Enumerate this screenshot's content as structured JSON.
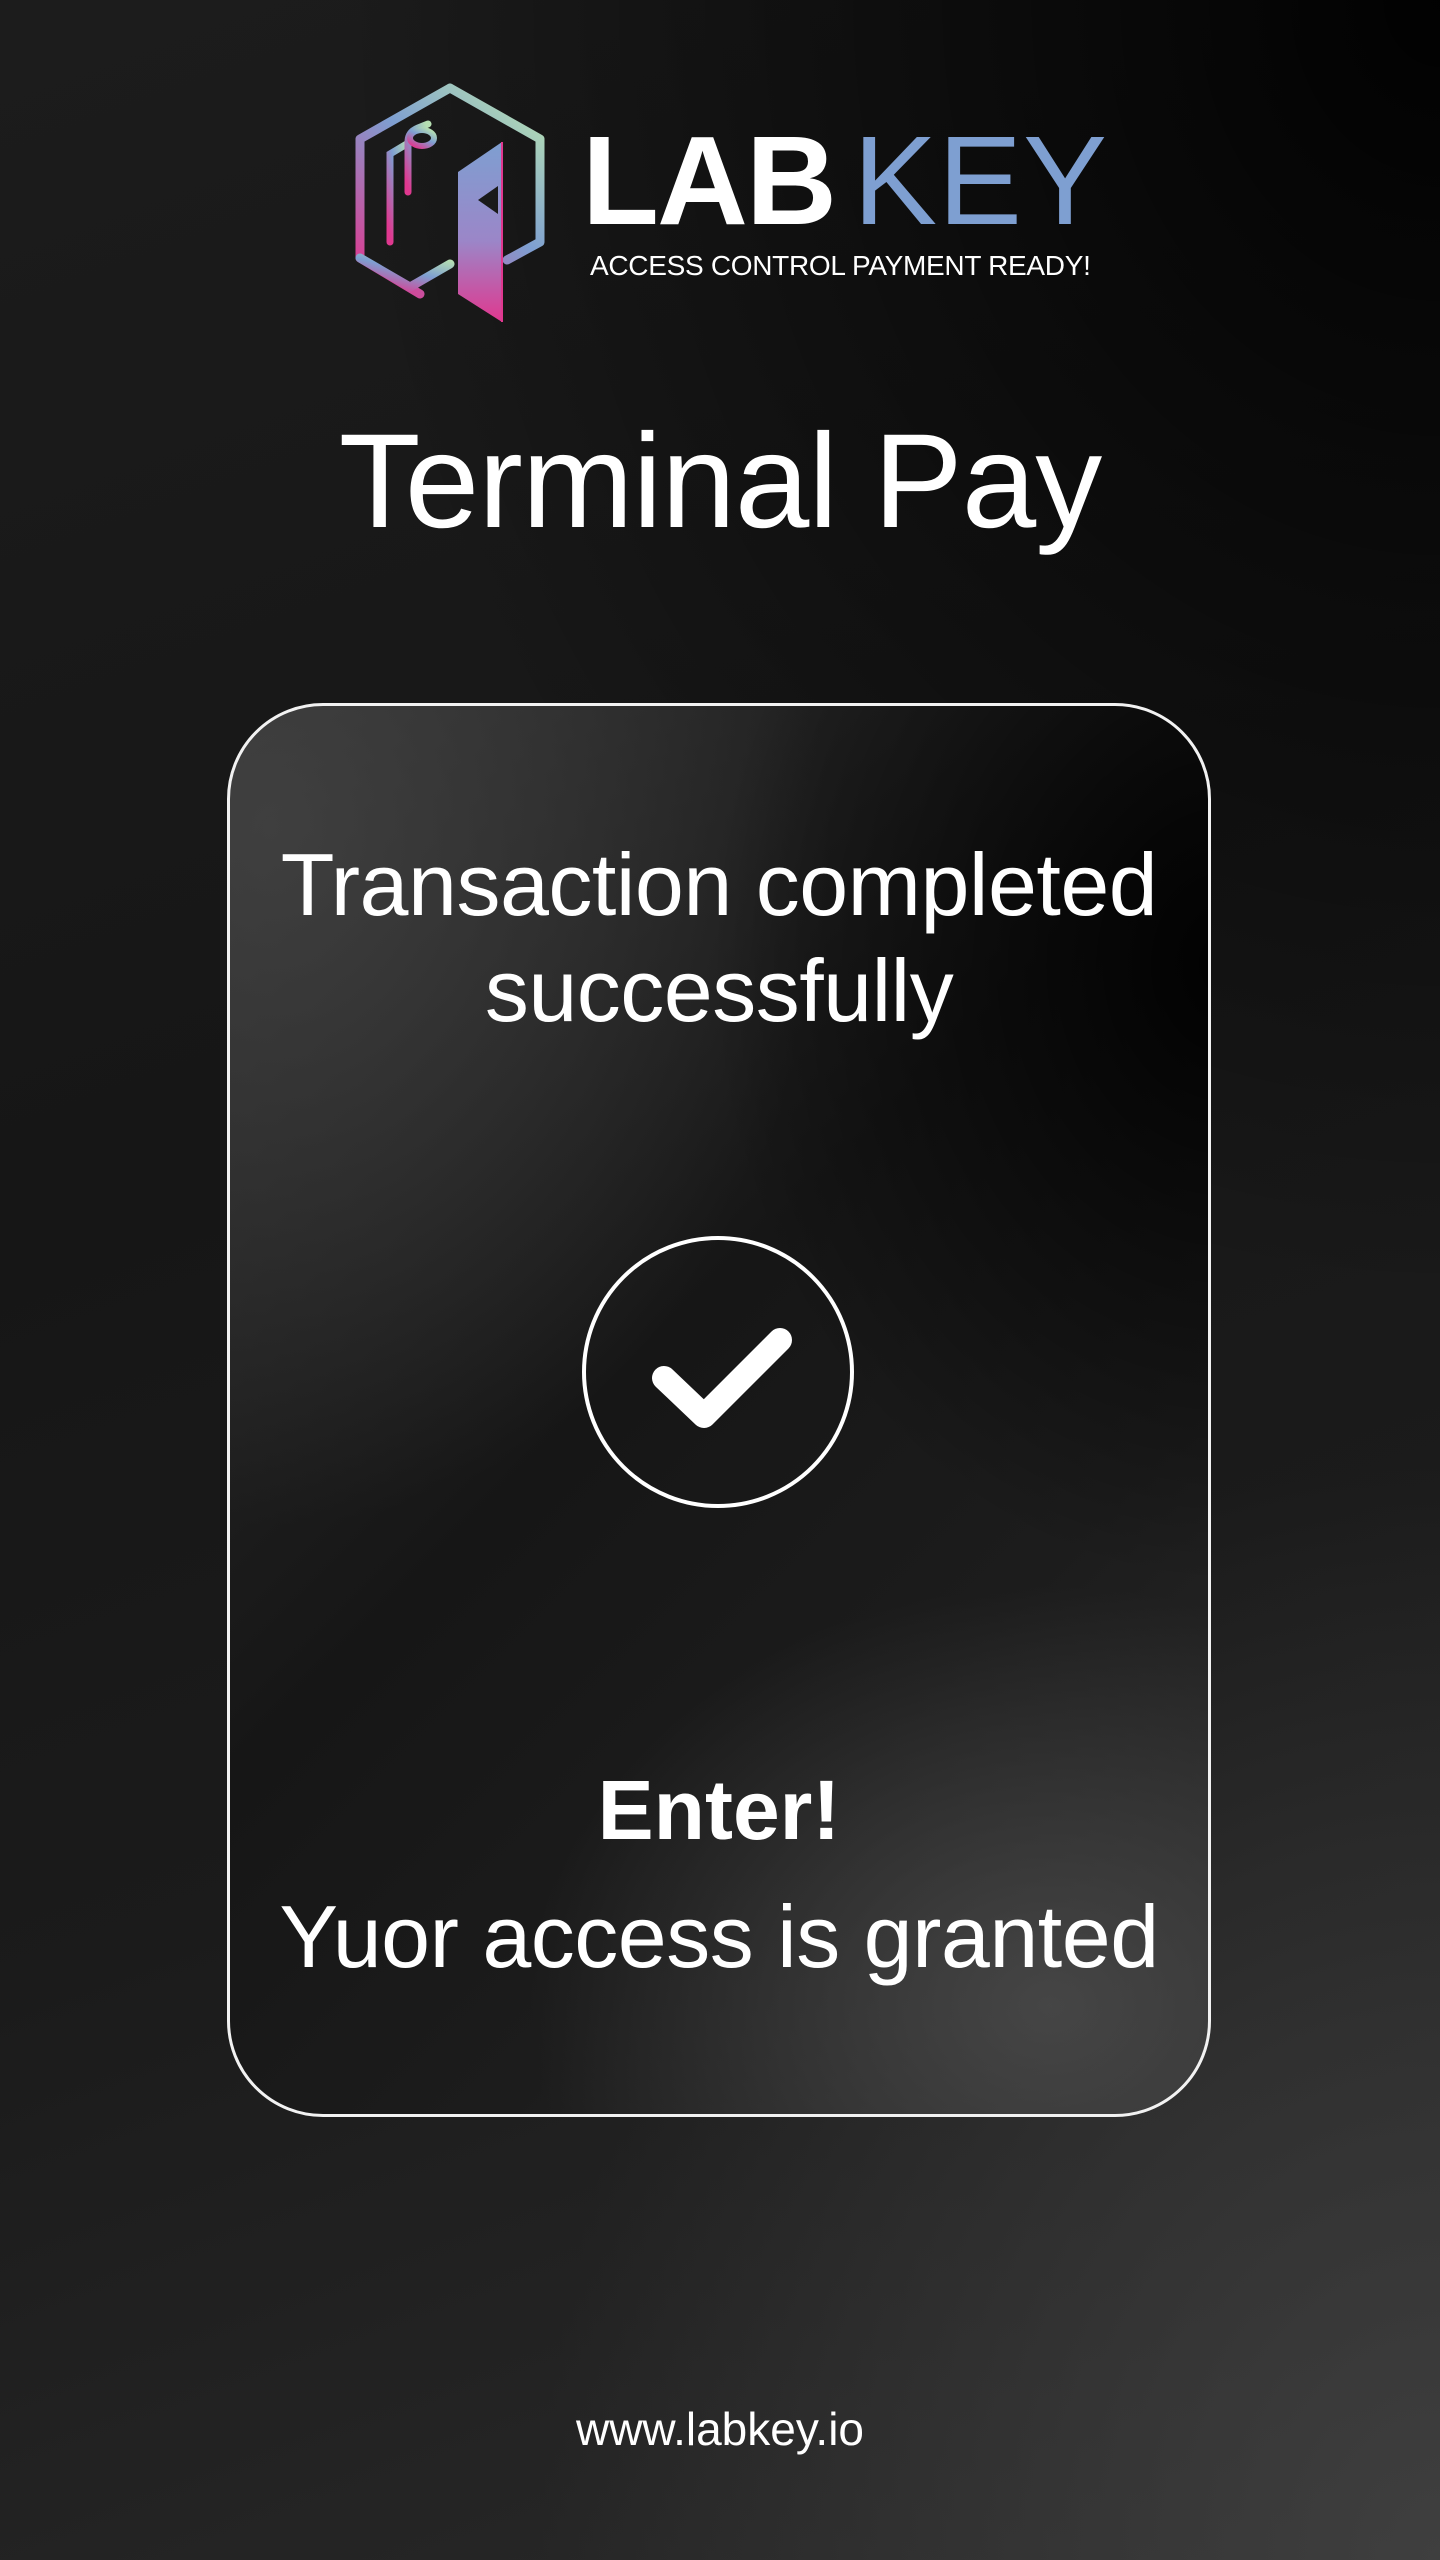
{
  "brand": {
    "name_bold": "LAB",
    "name_light": "KEY",
    "tagline": "ACCESS CONTROL PAYMENT READY!",
    "logo_icon": "hexagon-door-icon",
    "accent_color": "#7e9fd1",
    "gradient_colors": [
      "#a8d8b0",
      "#7e9fd1",
      "#e03a8f"
    ]
  },
  "page": {
    "title": "Terminal Pay"
  },
  "card": {
    "message_line1": "Transaction completed",
    "message_line2": "successfully",
    "status_icon": "checkmark-circle-icon",
    "enter_label": "Enter!",
    "access_message": "Yuor access is granted"
  },
  "footer": {
    "url": "www.labkey.io"
  }
}
